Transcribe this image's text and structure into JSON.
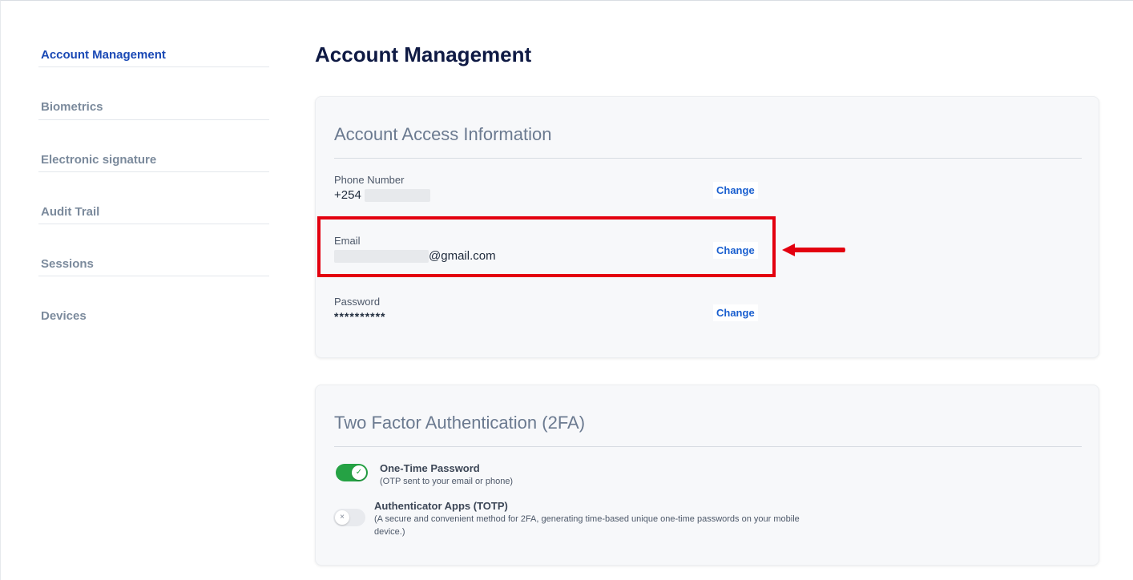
{
  "sidebar": {
    "items": [
      {
        "label": "Account Management",
        "active": true
      },
      {
        "label": "Biometrics",
        "active": false
      },
      {
        "label": "Electronic signature",
        "active": false
      },
      {
        "label": "Audit Trail",
        "active": false
      },
      {
        "label": "Sessions",
        "active": false
      },
      {
        "label": "Devices",
        "active": false
      }
    ]
  },
  "main": {
    "title": "Account Management",
    "access": {
      "title": "Account Access Information",
      "phone": {
        "label": "Phone Number",
        "value": "+254",
        "action": "Change"
      },
      "email": {
        "label": "Email",
        "value": "@gmail.com",
        "action": "Change"
      },
      "password": {
        "label": "Password",
        "value": "**********",
        "action": "Change"
      }
    },
    "twofa": {
      "title": "Two Factor Authentication (2FA)",
      "otp": {
        "title": "One-Time Password",
        "desc": "(OTP sent to your email or phone)",
        "enabled": true
      },
      "totp": {
        "title": "Authenticator Apps (TOTP)",
        "desc": "(A secure and convenient method for 2FA, generating time-based unique one-time passwords on your mobile device.)",
        "enabled": false
      }
    }
  },
  "colors": {
    "accent": "#1a49b5",
    "highlight": "#e3000f",
    "toggle_on": "#25a244"
  },
  "icons": {
    "toggle_on": "check-icon",
    "toggle_off": "x-icon",
    "annotation": "arrow-left-icon"
  }
}
